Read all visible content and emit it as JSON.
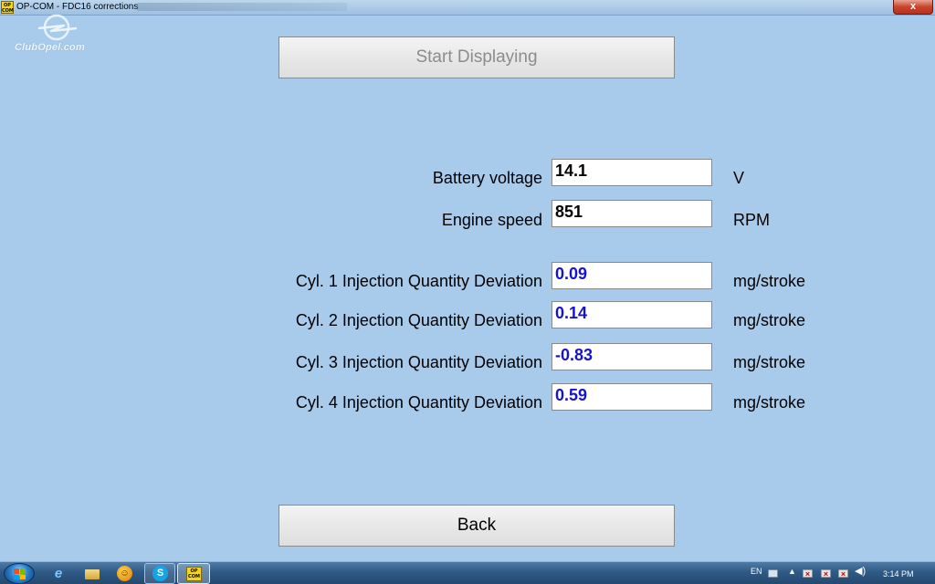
{
  "window": {
    "title": "OP-COM - FDC16 corrections",
    "app_icon_text": "OP COM",
    "close_glyph": "x"
  },
  "watermark": {
    "text": "ClubOpel.com"
  },
  "buttons": {
    "start_label": "Start Displaying",
    "back_label": "Back"
  },
  "readings": [
    {
      "label": "Battery voltage",
      "value": "14.1",
      "unit": "V"
    },
    {
      "label": "Engine speed",
      "value": "851",
      "unit": "RPM"
    },
    {
      "label": "Cyl. 1 Injection Quantity Deviation",
      "value": "0.09",
      "unit": "mg/stroke"
    },
    {
      "label": "Cyl. 2 Injection Quantity Deviation",
      "value": "0.14",
      "unit": "mg/stroke"
    },
    {
      "label": "Cyl. 3 Injection Quantity Deviation",
      "value": "-0.83",
      "unit": "mg/stroke"
    },
    {
      "label": "Cyl. 4 Injection Quantity Deviation",
      "value": "0.59",
      "unit": "mg/stroke"
    }
  ],
  "colors": {
    "background": "#a8cbec",
    "deviation_value": "#1414d0",
    "disabled_text": "#8c8c8c"
  },
  "taskbar": {
    "items": [
      {
        "icon": "windows-start-icon"
      },
      {
        "icon": "internet-explorer-icon"
      },
      {
        "icon": "file-explorer-icon"
      },
      {
        "icon": "messenger-smiley-icon"
      },
      {
        "icon": "skype-icon",
        "glyph": "S"
      },
      {
        "icon": "opcom-icon",
        "glyph": "OP COM"
      }
    ],
    "tray": {
      "language": "EN",
      "clock": "3:14 PM",
      "icons": [
        "keyboard-icon",
        "show-hidden-icons-icon",
        "action-center-flag-icon",
        "power-icon",
        "network-icon",
        "volume-icon"
      ]
    }
  }
}
